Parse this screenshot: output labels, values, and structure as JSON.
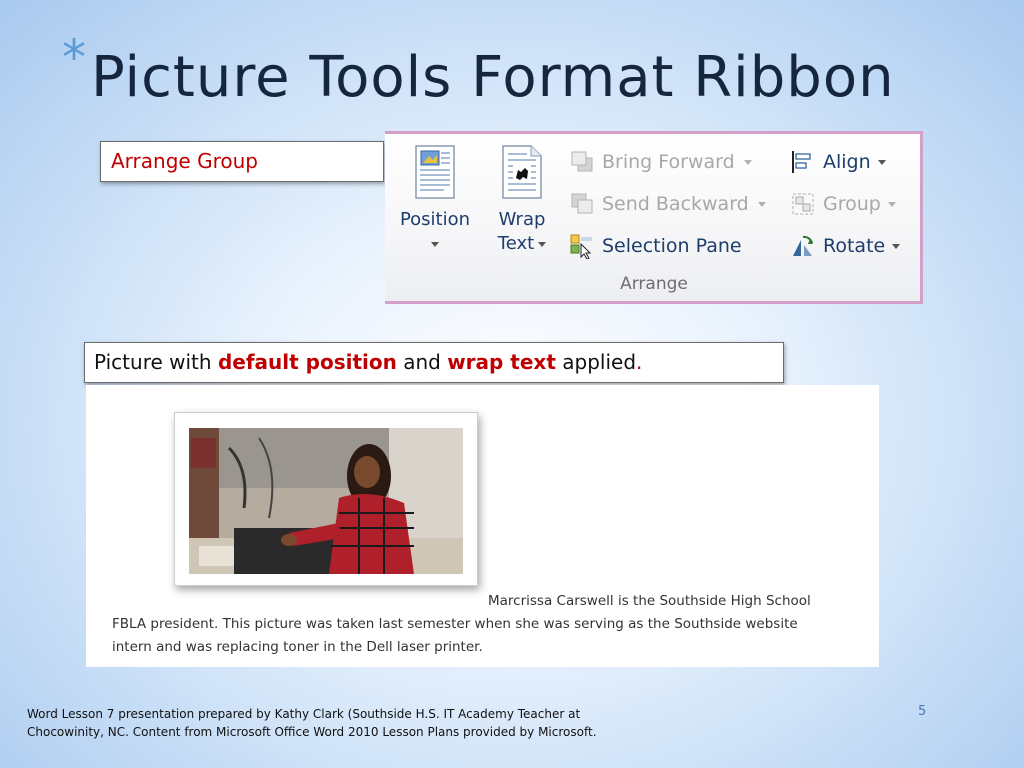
{
  "slide": {
    "title": "Picture Tools Format Ribbon",
    "bullet": "*",
    "page_number": "5"
  },
  "arrange_label": "Arrange Group",
  "ribbon": {
    "group_label": "Arrange",
    "position": {
      "label": "Position",
      "icon": "position-icon"
    },
    "wrap_text": {
      "label_line1": "Wrap",
      "label_line2": "Text",
      "icon": "wrap-text-icon"
    },
    "bring_forward": {
      "label": "Bring Forward",
      "icon": "bring-forward-icon",
      "enabled": false
    },
    "send_backward": {
      "label": "Send Backward",
      "icon": "send-backward-icon",
      "enabled": false
    },
    "selection_pane": {
      "label": "Selection Pane",
      "icon": "selection-pane-icon",
      "enabled": true
    },
    "align": {
      "label": "Align",
      "icon": "align-icon",
      "enabled": true
    },
    "group": {
      "label": "Group",
      "icon": "group-icon",
      "enabled": false
    },
    "rotate": {
      "label": "Rotate",
      "icon": "rotate-icon",
      "enabled": true
    },
    "accent_color": "#d4a0c8"
  },
  "caption": {
    "prefix": "Picture with ",
    "highlight1": "default position",
    "middle": " and ",
    "highlight2": "wrap text",
    "suffix": " applied",
    "period": "."
  },
  "document": {
    "line1": "Marcrissa Carswell is the Southside High School",
    "line2": "FBLA president. This picture was taken last semester when she was serving as the Southside website",
    "line3": "intern and was replacing toner in the Dell laser printer."
  },
  "footer": {
    "line1": "Word Lesson 7 presentation prepared by Kathy Clark (Southside H.S. IT Academy Teacher at",
    "line2": "Chocowinity, NC. Content from Microsoft Office Word 2010 Lesson Plans provided by Microsoft."
  },
  "colors": {
    "highlight": "#c00000",
    "title": "#16263f",
    "ribbon_text": "#1d3d6b",
    "disabled_text": "#a8a8a8"
  }
}
